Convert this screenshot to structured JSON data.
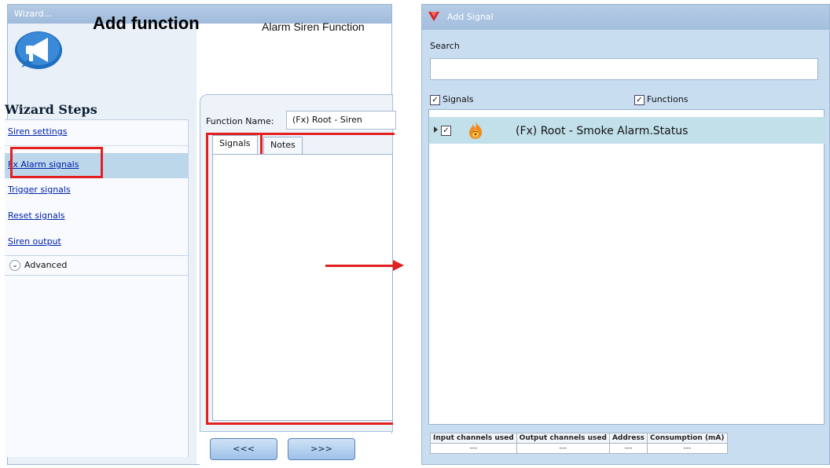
{
  "wizard": {
    "window_title": "Wizard...",
    "heading": "Add function",
    "subheading": "Alarm Siren Function",
    "steps_title": "Wizard Steps",
    "steps": [
      {
        "label": "Siren settings"
      },
      {
        "label": "Fx Alarm signals"
      },
      {
        "label": "Trigger signals"
      },
      {
        "label": "Reset signals"
      },
      {
        "label": "Siren output"
      }
    ],
    "active_step": "Fx Alarm signals",
    "advanced_label": "Advanced",
    "function_name_label": "Function Name:",
    "function_name_value": "(Fx) Root - Siren",
    "tabs": [
      {
        "label": "Signals"
      },
      {
        "label": "Notes"
      }
    ],
    "back_button": "<<<",
    "next_button": ">>>"
  },
  "add_signal": {
    "window_title": "Add Signal",
    "search_label": "Search",
    "search_value": "",
    "filters": {
      "signals_label": "Signals",
      "signals_checked": true,
      "functions_label": "Functions",
      "functions_checked": true
    },
    "rows": [
      {
        "label": "(Fx) Root - Smoke Alarm.Status",
        "checked": true,
        "icon": "fire-alarm-icon"
      }
    ],
    "stats": {
      "headers": [
        "Input channels used",
        "Output channels used",
        "Address",
        "Consumption (mA)"
      ],
      "values": [
        "---",
        "---",
        "---",
        "---"
      ]
    }
  },
  "colors": {
    "highlight_red": "#e32020",
    "title_bar": "#a3bedd",
    "selected_row": "#c2e0ea",
    "active_step": "#bcd6ea"
  }
}
